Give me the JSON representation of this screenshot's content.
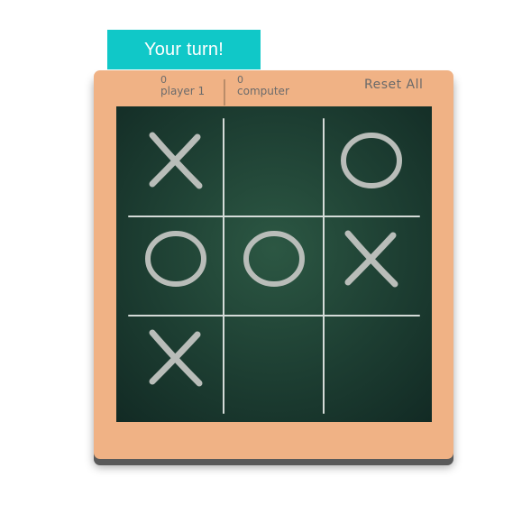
{
  "status": {
    "turn_message": "Your turn!"
  },
  "scoreboard": {
    "player": {
      "score": "0",
      "label": "player 1"
    },
    "computer": {
      "score": "0",
      "label": "computer"
    },
    "reset_label": "Reset All"
  },
  "board": {
    "cells": [
      "X",
      "",
      "O",
      "O",
      "O",
      "X",
      "X",
      "",
      ""
    ]
  },
  "colors": {
    "banner": "#10c8c8",
    "frame": "#f0b285",
    "board": "#1f4034",
    "chalk": "#b9bdb9"
  }
}
